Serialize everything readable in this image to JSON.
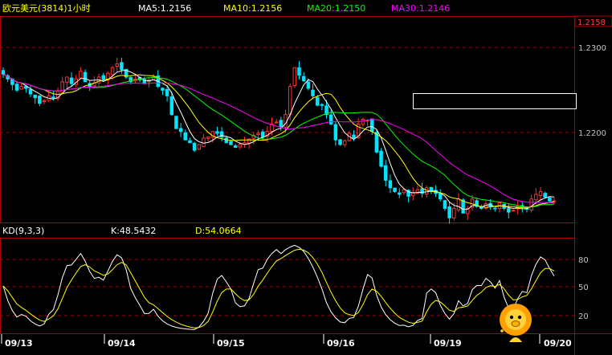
{
  "colors": {
    "background": "#000000",
    "frame": "#b00000",
    "grid": "#a00000",
    "up": "#ff3030",
    "down": "#00e5ff",
    "ma5": "#ffffff",
    "ma10": "#ffff00",
    "ma20": "#00ff00",
    "ma30": "#ff00ff",
    "k": "#ffffff",
    "d": "#ffff00",
    "title": "#ffff00"
  },
  "header": {
    "title": "欧元美元(3814)1小时",
    "ma5": "MA5:1.2156",
    "ma10": "MA10:1.2156",
    "ma20": "MA20:1.2150",
    "ma30": "MA30:1.2146"
  },
  "kd_header": {
    "name": "KD(9,3,3)",
    "k": "K:48.5432",
    "d": "D:54.0664"
  },
  "dates": [
    "09/13",
    "09/14",
    "09/15",
    "09/16",
    "09/19",
    "09/20"
  ],
  "icon": "lion-mascot-icon",
  "chart_data": [
    {
      "type": "candlestick",
      "title": "欧元美元(3814)1小时",
      "ylim": [
        1.2135,
        1.2355
      ],
      "yticks": [
        "1.2300",
        "1.2200"
      ],
      "current_price": "1.2158",
      "x_date_labels": [
        "09/13",
        "09/14",
        "09/15",
        "09/16",
        "09/19",
        "09/20"
      ],
      "series": [
        {
          "name": "MA5",
          "last": 1.2156
        },
        {
          "name": "MA10",
          "last": 1.2156
        },
        {
          "name": "MA20",
          "last": 1.215
        },
        {
          "name": "MA30",
          "last": 1.2146
        }
      ],
      "close_path": [
        1.2293,
        1.2288,
        1.2282,
        1.2276,
        1.228,
        1.2278,
        1.2272,
        1.2268,
        1.2262,
        1.2265,
        1.227,
        1.2268,
        1.2275,
        1.2285,
        1.229,
        1.2283,
        1.2288,
        1.2296,
        1.2285,
        1.228,
        1.2284,
        1.229,
        1.2288,
        1.2294,
        1.23,
        1.2304,
        1.2298,
        1.229,
        1.2285,
        1.2288,
        1.2287,
        1.2283,
        1.2287,
        1.229,
        1.228,
        1.2276,
        1.227,
        1.225,
        1.2235,
        1.2232,
        1.2223,
        1.222,
        1.2212,
        1.2218,
        1.2225,
        1.2226,
        1.2232,
        1.223,
        1.2226,
        1.222,
        1.2218,
        1.2215,
        1.2218,
        1.222,
        1.2224,
        1.2228,
        1.223,
        1.2226,
        1.2232,
        1.224,
        1.2242,
        1.2237,
        1.225,
        1.228,
        1.23,
        1.2292,
        1.2286,
        1.2278,
        1.227,
        1.226,
        1.226,
        1.225,
        1.224,
        1.2223,
        1.2218,
        1.2222,
        1.223,
        1.2225,
        1.224,
        1.2245,
        1.2244,
        1.2232,
        1.221,
        1.2195,
        1.218,
        1.2172,
        1.2168,
        1.2165,
        1.217,
        1.2163,
        1.2167,
        1.217,
        1.2166,
        1.2172,
        1.2168,
        1.2166,
        1.216,
        1.215,
        1.214,
        1.215,
        1.216,
        1.2145,
        1.215,
        1.216,
        1.2152,
        1.215,
        1.2155,
        1.2152,
        1.215,
        1.2156,
        1.215,
        1.2146,
        1.2148,
        1.2152,
        1.2152,
        1.215,
        1.216,
        1.2165,
        1.2168,
        1.2162,
        1.2158,
        1.2158
      ]
    },
    {
      "type": "line",
      "title": "KD(9,3,3)",
      "ylim": [
        0,
        100
      ],
      "yticks": [
        "80",
        "50",
        "20"
      ],
      "series": [
        {
          "name": "K",
          "last": 48.5432
        },
        {
          "name": "D",
          "last": 54.0664
        }
      ]
    }
  ]
}
